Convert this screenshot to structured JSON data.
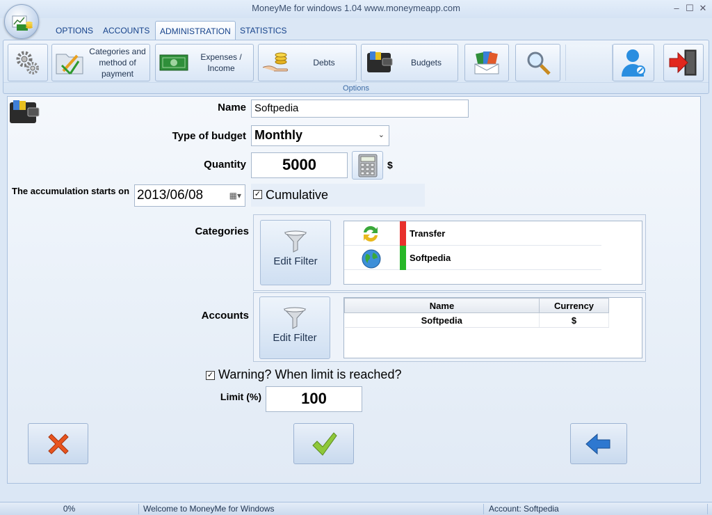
{
  "window": {
    "title": "MoneyMe for windows 1.04 www.moneymeapp.com"
  },
  "tabs": [
    {
      "label": "OPTIONS"
    },
    {
      "label": "ACCOUNTS"
    },
    {
      "label": "ADMINISTRATION",
      "active": true
    },
    {
      "label": "STATISTICS"
    }
  ],
  "ribbon": {
    "categories_label": "Categories and method of payment",
    "expenses_label": "Expenses / Income",
    "debts_label": "Debts",
    "budgets_label": "Budgets",
    "group_label": "Options"
  },
  "form": {
    "name_label": "Name",
    "name_value": "Softpedia",
    "type_label": "Type of budget",
    "type_value": "Monthly",
    "quantity_label": "Quantity",
    "quantity_value": "5000",
    "currency_symbol": "$",
    "start_label": "The accumulation starts on",
    "start_value": "2013/06/08",
    "cumulative_label": "Cumulative",
    "cumulative_checked": true,
    "categories_label": "Categories",
    "accounts_label": "Accounts",
    "edit_filter_label": "Edit Filter",
    "warning_label": "Warning? When limit is reached?",
    "warning_checked": true,
    "limit_label": "Limit (%)",
    "limit_value": "100"
  },
  "categories": [
    {
      "name": "Transfer",
      "color": "#e8302c"
    },
    {
      "name": "Softpedia",
      "color": "#28b728"
    }
  ],
  "accounts_table": {
    "headers": [
      "Name",
      "Currency"
    ],
    "rows": [
      {
        "name": "Softpedia",
        "currency": "$"
      }
    ]
  },
  "statusbar": {
    "progress": "0%",
    "message": "Welcome to MoneyMe for Windows",
    "account": "Account: Softpedia"
  }
}
